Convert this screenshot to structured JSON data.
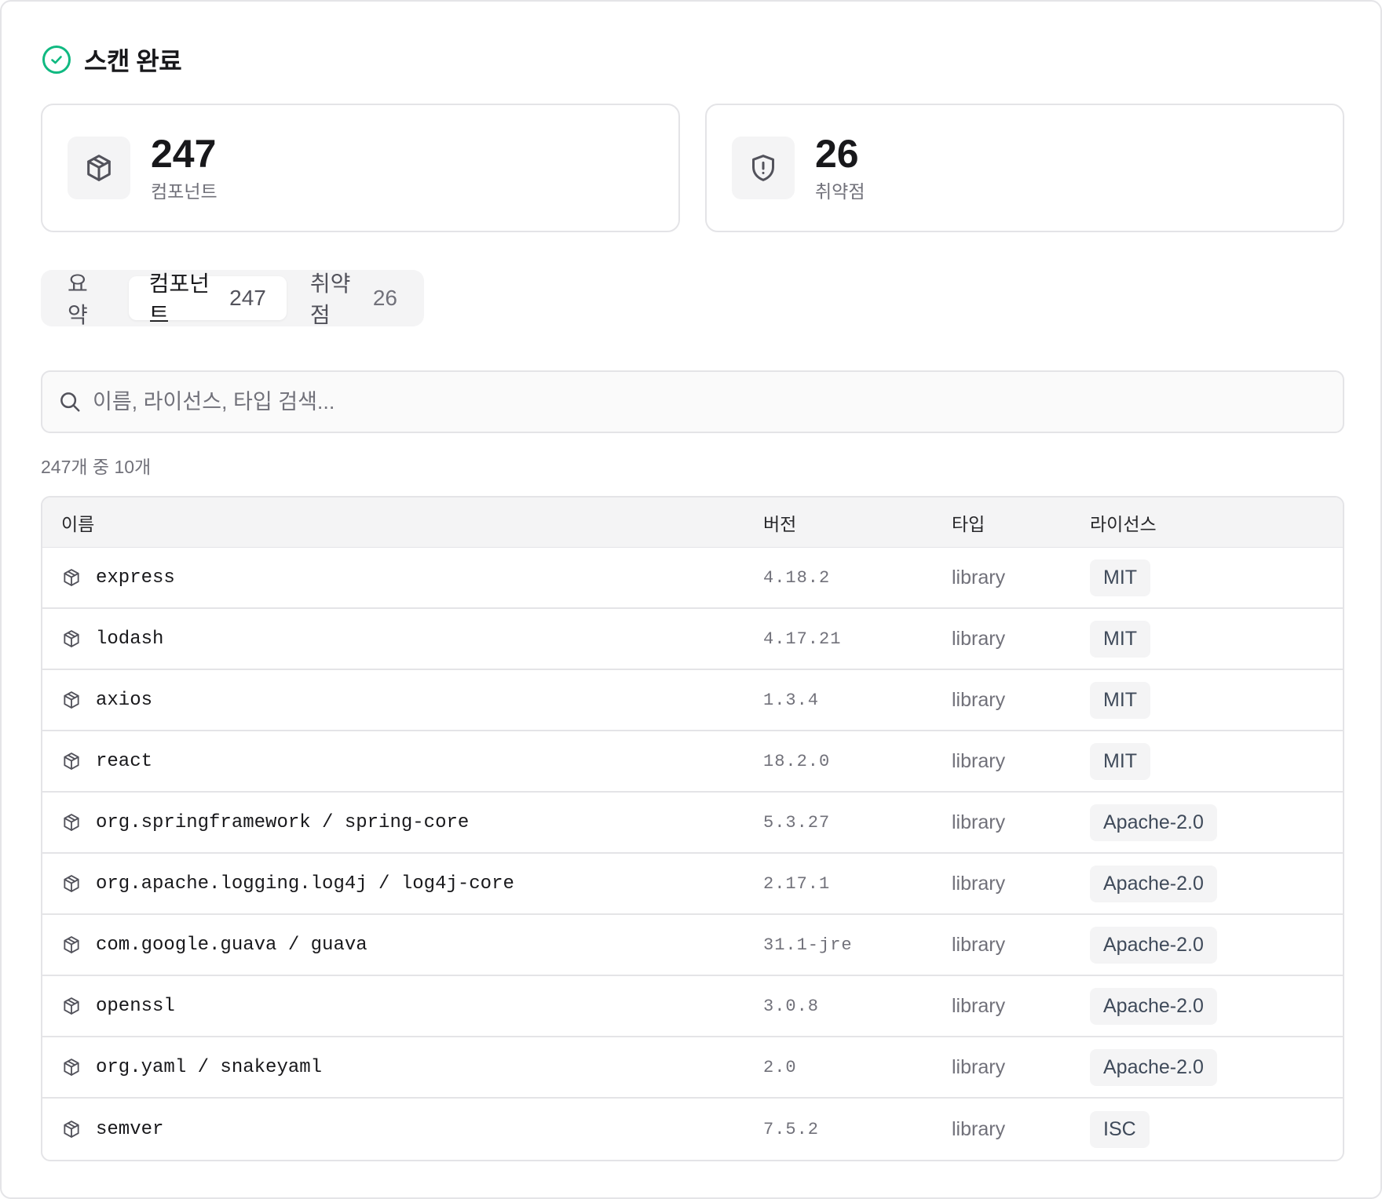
{
  "header": {
    "title": "스캔 완료",
    "status_color": "#10b981"
  },
  "stats": [
    {
      "value": "247",
      "label": "컴포넌트",
      "icon": "package-icon"
    },
    {
      "value": "26",
      "label": "취약점",
      "icon": "shield-alert-icon"
    }
  ],
  "tabs": [
    {
      "label": "요약",
      "count": ""
    },
    {
      "label": "컴포넌트",
      "count": "247",
      "active": true
    },
    {
      "label": "취약점",
      "count": "26"
    }
  ],
  "search": {
    "placeholder": "이름, 라이선스, 타입 검색...",
    "value": ""
  },
  "result_count": "247개 중 10개",
  "table": {
    "headers": {
      "name": "이름",
      "version": "버전",
      "type": "타입",
      "license": "라이선스"
    },
    "rows": [
      {
        "name": "express",
        "version": "4.18.2",
        "type": "library",
        "license": "MIT"
      },
      {
        "name": "lodash",
        "version": "4.17.21",
        "type": "library",
        "license": "MIT"
      },
      {
        "name": "axios",
        "version": "1.3.4",
        "type": "library",
        "license": "MIT"
      },
      {
        "name": "react",
        "version": "18.2.0",
        "type": "library",
        "license": "MIT"
      },
      {
        "name": "org.springframework / spring-core",
        "version": "5.3.27",
        "type": "library",
        "license": "Apache-2.0"
      },
      {
        "name": "org.apache.logging.log4j / log4j-core",
        "version": "2.17.1",
        "type": "library",
        "license": "Apache-2.0"
      },
      {
        "name": "com.google.guava / guava",
        "version": "31.1-jre",
        "type": "library",
        "license": "Apache-2.0"
      },
      {
        "name": "openssl",
        "version": "3.0.8",
        "type": "library",
        "license": "Apache-2.0"
      },
      {
        "name": "org.yaml / snakeyaml",
        "version": "2.0",
        "type": "library",
        "license": "Apache-2.0"
      },
      {
        "name": "semver",
        "version": "7.5.2",
        "type": "library",
        "license": "ISC"
      }
    ]
  }
}
